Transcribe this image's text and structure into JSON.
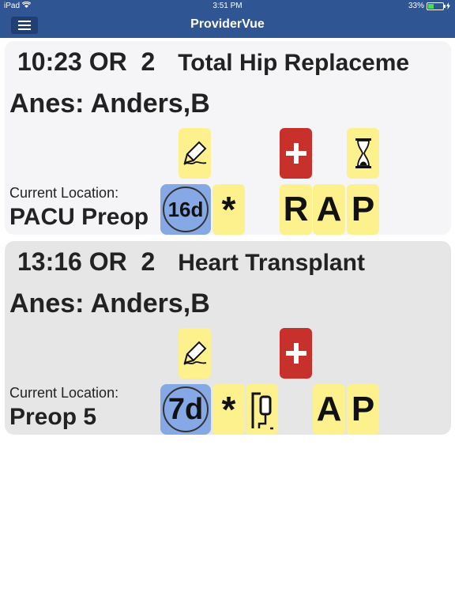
{
  "status_bar": {
    "device": "iPad",
    "time": "3:51 PM",
    "battery": "33%"
  },
  "nav": {
    "title": "ProviderVue"
  },
  "cases": [
    {
      "time": "10:23",
      "room": "OR  2",
      "procedure": "Total Hip Replaceme",
      "anesthesia": "Anes: Anders,B",
      "location_label": "Current Location:",
      "location": "PACU Preop",
      "days": "16d",
      "star": "*",
      "letters": [
        "R",
        "A",
        "P"
      ]
    },
    {
      "time": "13:16",
      "room": "OR  2",
      "procedure": "Heart Transplant",
      "anesthesia": "Anes: Anders,B",
      "location_label": "Current Location:",
      "location": "Preop 5",
      "days": "7d",
      "star": "*",
      "letters": [
        "A",
        "P"
      ]
    }
  ],
  "colors": {
    "nav_bar": "#2f5592",
    "tile_yellow": "#fdf18d",
    "tile_red": "#c8302c",
    "tile_blue": "#86a8e4"
  }
}
